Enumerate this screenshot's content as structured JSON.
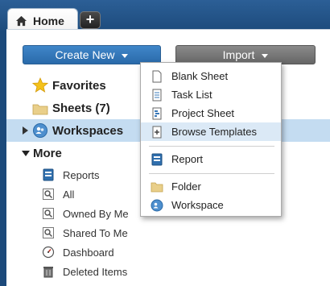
{
  "tabs": {
    "home_label": "Home",
    "add_label": "+"
  },
  "toolbar": {
    "create_label": "Create New",
    "import_label": "Import"
  },
  "nav": {
    "favorites": "Favorites",
    "sheets": "Sheets (7)",
    "workspaces": "Workspaces",
    "more": "More"
  },
  "more_items": [
    "Reports",
    "All",
    "Owned By Me",
    "Shared To Me",
    "Dashboard",
    "Deleted Items"
  ],
  "create_menu": {
    "blank_sheet": "Blank Sheet",
    "task_list": "Task List",
    "project_sheet": "Project Sheet",
    "browse_templates": "Browse Templates",
    "report": "Report",
    "folder": "Folder",
    "workspace": "Workspace"
  },
  "colors": {
    "header_bg": "#1f4f82",
    "create_button": "#3479bd",
    "import_button": "#777777",
    "selected_row": "#c4dcf1",
    "highlight_item": "#dbe9f6"
  },
  "icons": {
    "home": "house-icon",
    "favorites": "star-icon",
    "sheets": "folder-icon",
    "workspaces": "workspace-icon",
    "reports": "report-icon",
    "all": "search-icon",
    "dashboard": "gauge-icon",
    "deleted": "trash-icon"
  }
}
